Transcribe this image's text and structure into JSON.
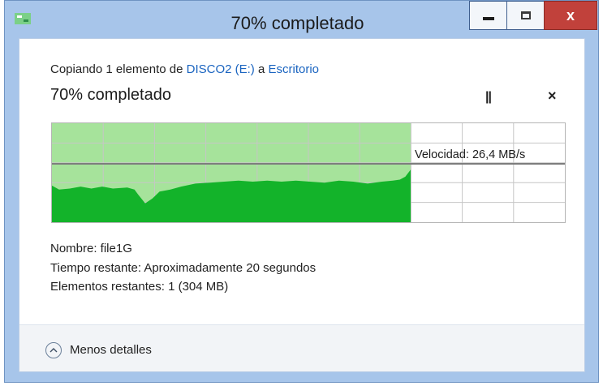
{
  "window": {
    "title": "70% completado"
  },
  "caption_buttons": {
    "minimize": "minimize-icon",
    "maximize": "maximize-icon",
    "close": "close-icon"
  },
  "copy": {
    "prefix": "Copiando 1 elemento de ",
    "source": "DISCO2 (E:)",
    "middle": " a ",
    "destination": "Escritorio"
  },
  "progress": {
    "heading": "70% completado",
    "percent": 70,
    "speed_label": "Velocidad: 26,4 MB/s"
  },
  "controls": {
    "pause_icon": "pause-icon",
    "cancel_icon": "close-icon"
  },
  "details": {
    "name": "Nombre: file1G",
    "time_remaining": "Tiempo restante: Aproximadamente 20 segundos",
    "items_remaining": "Elementos restantes: 1 (304 MB)"
  },
  "footer": {
    "toggle_label": "Menos detalles",
    "toggle_icon": "chevron-up-icon"
  },
  "colors": {
    "progress_fill": "#a6e39b",
    "speed_fill": "#13b32a",
    "grid": "#c6c6c6",
    "speed_line": "#7d7d7d",
    "link": "#1a64c0",
    "close_button": "#c1413b"
  }
}
